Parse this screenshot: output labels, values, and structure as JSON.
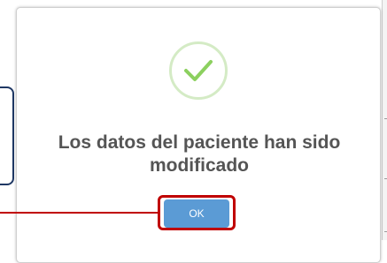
{
  "dialog": {
    "icon": "success-check-icon",
    "message_line1": "Los datos del paciente han sido",
    "message_line2": "modificado",
    "ok_label": "OK"
  },
  "colors": {
    "check_color": "#8cd05f",
    "check_ring": "#d4ebc5",
    "ok_button": "#5b9bd5",
    "highlight": "#c00000",
    "message_text": "#555555"
  }
}
